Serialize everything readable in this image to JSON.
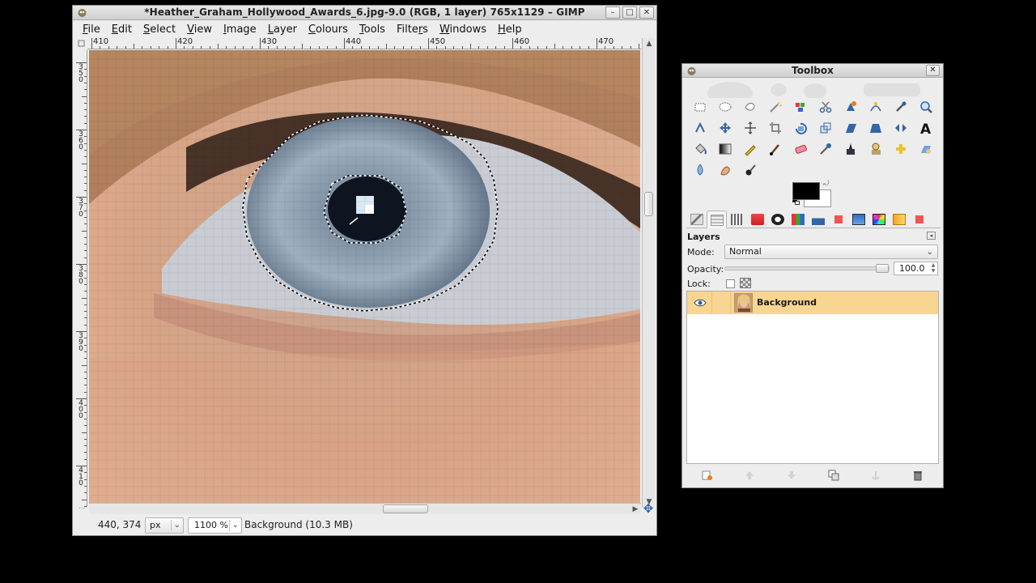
{
  "main_window": {
    "title": "*Heather_Graham_Hollywood_Awards_6.jpg-9.0 (RGB, 1 layer) 765x1129 – GIMP",
    "menu": [
      {
        "pre": "",
        "mn": "F",
        "post": "ile"
      },
      {
        "pre": "",
        "mn": "E",
        "post": "dit"
      },
      {
        "pre": "",
        "mn": "S",
        "post": "elect"
      },
      {
        "pre": "",
        "mn": "V",
        "post": "iew"
      },
      {
        "pre": "",
        "mn": "I",
        "post": "mage"
      },
      {
        "pre": "",
        "mn": "L",
        "post": "ayer"
      },
      {
        "pre": "",
        "mn": "C",
        "post": "olours"
      },
      {
        "pre": "",
        "mn": "T",
        "post": "ools"
      },
      {
        "pre": "Filte",
        "mn": "r",
        "post": "s"
      },
      {
        "pre": "",
        "mn": "W",
        "post": "indows"
      },
      {
        "pre": "",
        "mn": "H",
        "post": "elp"
      }
    ],
    "ruler_h_labels": [
      "410",
      "420",
      "430",
      "440",
      "450",
      "460",
      "470"
    ],
    "ruler_v_labels": [
      "350",
      "360",
      "370",
      "380",
      "390",
      "400",
      "410"
    ],
    "status": {
      "coords": "440, 374",
      "unit": "px",
      "zoom": "1100 %",
      "message": "Background (10.3 MB)"
    }
  },
  "toolbox": {
    "title": "Toolbox",
    "tools": [
      "rect-select",
      "ellipse-select",
      "free-select",
      "fuzzy-select",
      "by-color-select",
      "scissors",
      "foreground-select",
      "paths",
      "color-picker",
      "zoom",
      "measure",
      "move",
      "align",
      "crop",
      "rotate",
      "scale",
      "shear",
      "perspective",
      "flip",
      "text",
      "bucket-fill",
      "blend",
      "pencil",
      "paintbrush",
      "eraser",
      "airbrush",
      "ink",
      "clone",
      "heal",
      "perspective-clone",
      "blur",
      "smudge",
      "dodge-burn"
    ],
    "layers_panel": {
      "label": "Layers",
      "mode_label": "Mode:",
      "mode_value": "Normal",
      "opacity_label": "Opacity:",
      "opacity_value": "100.0",
      "opacity_level": 1.0,
      "lock_label": "Lock:",
      "layers": [
        {
          "name": "Background",
          "visible": true,
          "selected": true
        }
      ]
    }
  },
  "colors": {
    "selection_bg": "#f9d592",
    "accent_blue": "#2b5ea8",
    "foreground": "#000000",
    "background": "#ffffff"
  }
}
